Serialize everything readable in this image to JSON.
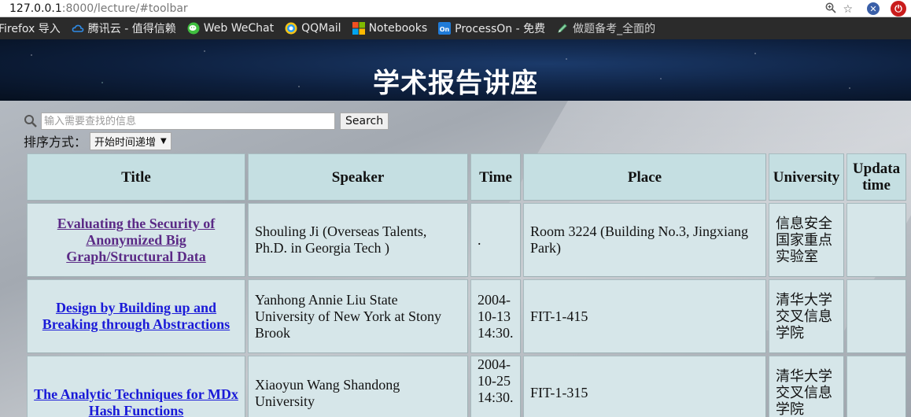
{
  "browser": {
    "url_host": "127.0.0.1",
    "url_rest": ":8000/lecture/#toolbar",
    "bookmarks": [
      {
        "label": "Firefox 导入",
        "icon": "none"
      },
      {
        "label": "腾讯云 - 值得信赖",
        "icon": "cloud-icon"
      },
      {
        "label": "Web WeChat",
        "icon": "wechat-icon"
      },
      {
        "label": "QQMail",
        "icon": "qqmail-icon"
      },
      {
        "label": "Notebooks",
        "icon": "microsoft-icon"
      },
      {
        "label": "ProcessOn - 免费",
        "icon": "processon-icon"
      },
      {
        "label": "做题备考_全面的",
        "icon": "pen-icon"
      }
    ]
  },
  "page": {
    "title": "学术报告讲座",
    "search": {
      "placeholder": "输入需要查找的信息",
      "button": "Search"
    },
    "sort": {
      "label": "排序方式：",
      "selected": "开始时间递增"
    }
  },
  "table": {
    "headers": [
      "Title",
      "Speaker",
      "Time",
      "Place",
      "University",
      "Updata time"
    ],
    "rows": [
      {
        "title": "Evaluating the Security of Anonymized Big Graph/Structural Data",
        "visited": true,
        "speaker": "Shouling Ji (Overseas Talents, Ph.D. in Georgia Tech )",
        "time": ".",
        "place": "Room 3224 (Building No.3, Jingxiang Park)",
        "university": "信息安全国家重点实验室",
        "updated": ""
      },
      {
        "title": "Design by Building up and Breaking through Abstractions",
        "visited": false,
        "speaker": "Yanhong Annie Liu State University of New York at Stony Brook",
        "time": "2004-10-13 14:30.",
        "place": "FIT-1-415",
        "university": "清华大学交叉信息学院",
        "updated": ""
      },
      {
        "title": "The Analytic Techniques for MDx Hash Functions",
        "visited": false,
        "speaker": "Xiaoyun Wang Shandong University",
        "time": "2004-10-25 14:30.",
        "place": "FIT-1-315",
        "university": "清华大学交叉信息学院",
        "updated": ""
      }
    ]
  },
  "colors": {
    "bookmarks_bg": "#2b2b2b",
    "header_cell": "#c5dfe2",
    "body_cell": "#d6e6e9",
    "visited_link": "#5b2a86",
    "link": "#1a1ad8"
  }
}
